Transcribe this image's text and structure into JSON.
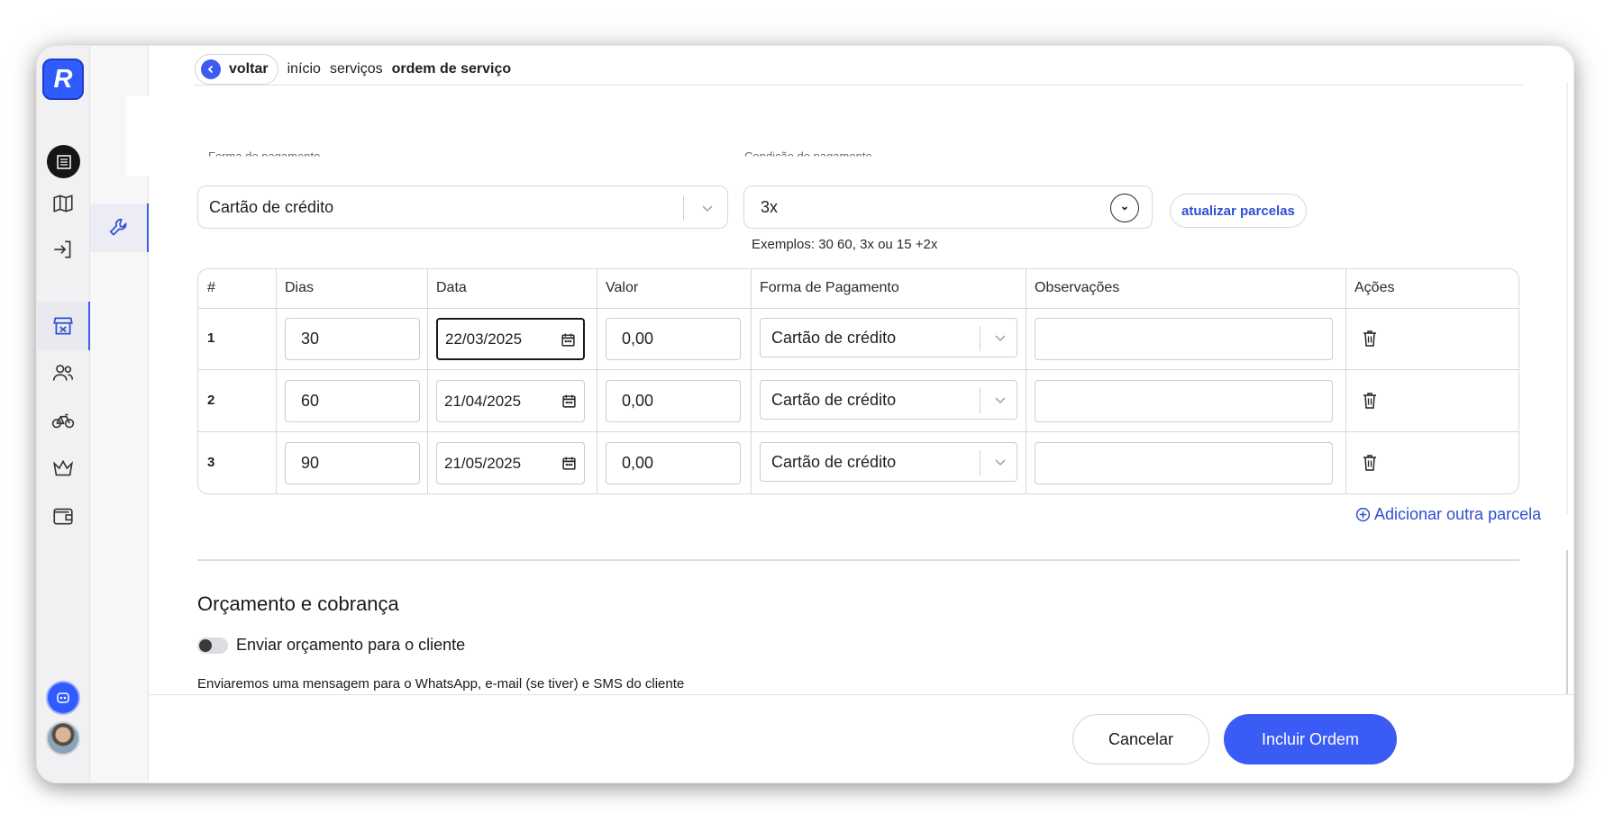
{
  "app": {
    "logo_letter": "R"
  },
  "sidebar": {
    "icons": [
      "map-icon",
      "login-icon",
      "store-icon",
      "users-icon",
      "bike-icon",
      "crown-icon",
      "wallet-icon"
    ],
    "active_index": 2
  },
  "submenu": {
    "active_icon": "wrench-icon"
  },
  "breadcrumb": {
    "back_label": "voltar",
    "items": [
      "início",
      "serviços",
      "ordem de serviço"
    ]
  },
  "payment": {
    "method_label": "Forma de pagamento",
    "method_value": "Cartão de crédito",
    "condition_label": "Condição de pagamento",
    "condition_value": "3x",
    "update_button": "atualizar parcelas",
    "hint": "Exemplos: 30 60, 3x ou 15 +2x"
  },
  "installments": {
    "columns": [
      "#",
      "Dias",
      "Data",
      "Valor",
      "Forma de Pagamento",
      "Observações",
      "Ações"
    ],
    "rows": [
      {
        "num": "1",
        "days": "30",
        "date": "22/03/2025",
        "value": "0,00",
        "method": "Cartão de crédito",
        "notes": ""
      },
      {
        "num": "2",
        "days": "60",
        "date": "21/04/2025",
        "value": "0,00",
        "method": "Cartão de crédito",
        "notes": ""
      },
      {
        "num": "3",
        "days": "90",
        "date": "21/05/2025",
        "value": "0,00",
        "method": "Cartão de crédito",
        "notes": ""
      }
    ],
    "add_label": "Adicionar outra parcela"
  },
  "budget": {
    "title": "Orçamento e cobrança",
    "toggle_label": "Enviar orçamento para o cliente",
    "toggle_on": false,
    "note": "Enviaremos uma mensagem para o WhatsApp, e-mail (se tiver) e SMS do cliente"
  },
  "footer": {
    "cancel_label": "Cancelar",
    "submit_label": "Incluir Ordem"
  },
  "colors": {
    "accent": "#3b5bf5",
    "link": "#2f4fd0",
    "border": "#d6d8dd"
  }
}
